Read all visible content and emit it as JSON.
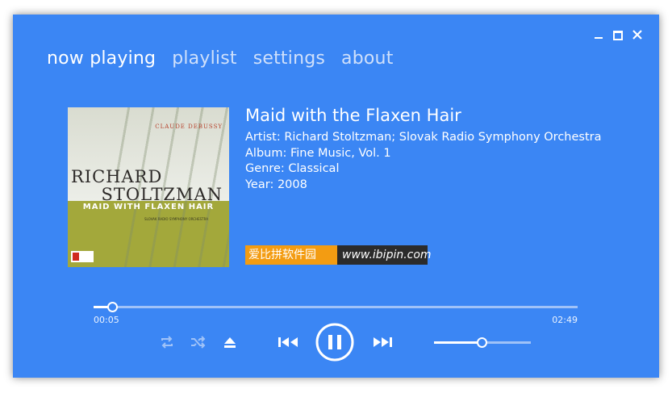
{
  "window": {
    "controls": {
      "minimize_icon": "minimize-icon",
      "maximize_icon": "maximize-icon",
      "close_icon": "close-icon"
    },
    "accent_color": "#3b86f4"
  },
  "tabs": [
    {
      "label": "now playing",
      "active": true
    },
    {
      "label": "playlist",
      "active": false
    },
    {
      "label": "settings",
      "active": false
    },
    {
      "label": "about",
      "active": false
    }
  ],
  "album_art": {
    "composer": "CLAUDE DEBUSSY",
    "artist_line1": "RICHARD",
    "artist_line2": "STOLTZMAN",
    "subtitle": "MAID WITH FLAXEN HAIR",
    "orchestra": "SLOVAK RADIO SYMPHONY ORCHESTRA"
  },
  "track": {
    "title": "Maid with the Flaxen Hair",
    "artist": "Artist: Richard Stoltzman; Slovak Radio Symphony Orchestra",
    "album": "Album: Fine Music, Vol. 1",
    "genre": "Genre: Classical",
    "year": "Year: 2008"
  },
  "watermark": {
    "cn": "爱比拼软件园",
    "url": "www.ibipin.com"
  },
  "playback": {
    "elapsed": "00:05",
    "duration": "02:49",
    "progress_fraction": 0.0296,
    "volume_fraction": 0.5
  },
  "controls": [
    "repeat-icon",
    "shuffle-icon",
    "eject-icon",
    "previous-icon",
    "pause-icon",
    "next-icon"
  ]
}
